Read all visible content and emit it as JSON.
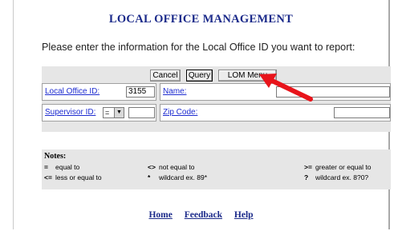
{
  "header": {
    "title": "LOCAL OFFICE MANAGEMENT"
  },
  "instructions": "Please enter the information for the Local Office ID you want to report:",
  "toolbar": {
    "cancel_label": "Cancel",
    "query_label": "Query",
    "lom_menu_label": "LOM Menu"
  },
  "form": {
    "local_office_id_label": "Local Office ID:",
    "local_office_id_value": "3155",
    "name_label": "Name:",
    "name_value": "",
    "supervisor_id_label": "Supervisor ID:",
    "supervisor_operator": "=",
    "supervisor_value": "",
    "zip_code_label": "Zip Code:",
    "zip_code_value": ""
  },
  "notes": {
    "title": "Notes:",
    "items": [
      {
        "symbol": "=",
        "text": "equal to"
      },
      {
        "symbol": "<>",
        "text": "not equal to"
      },
      {
        "symbol": ">=",
        "text": "greater or equal to"
      },
      {
        "symbol": "<=",
        "text": "less or equal to"
      },
      {
        "symbol": "*",
        "text": "wildcard ex. 89*"
      },
      {
        "symbol": "?",
        "text": "wildcard ex. 8?0?"
      }
    ]
  },
  "footer": {
    "links": [
      "Home",
      "Feedback",
      "Help"
    ]
  },
  "colors": {
    "title": "#1b2a8a",
    "link": "#1d2bd0",
    "panel": "#e6e6e6",
    "arrow": "#e8141b"
  },
  "icons": {
    "annotation": "red-arrow-icon",
    "dropdown": "chevron-down-icon"
  }
}
